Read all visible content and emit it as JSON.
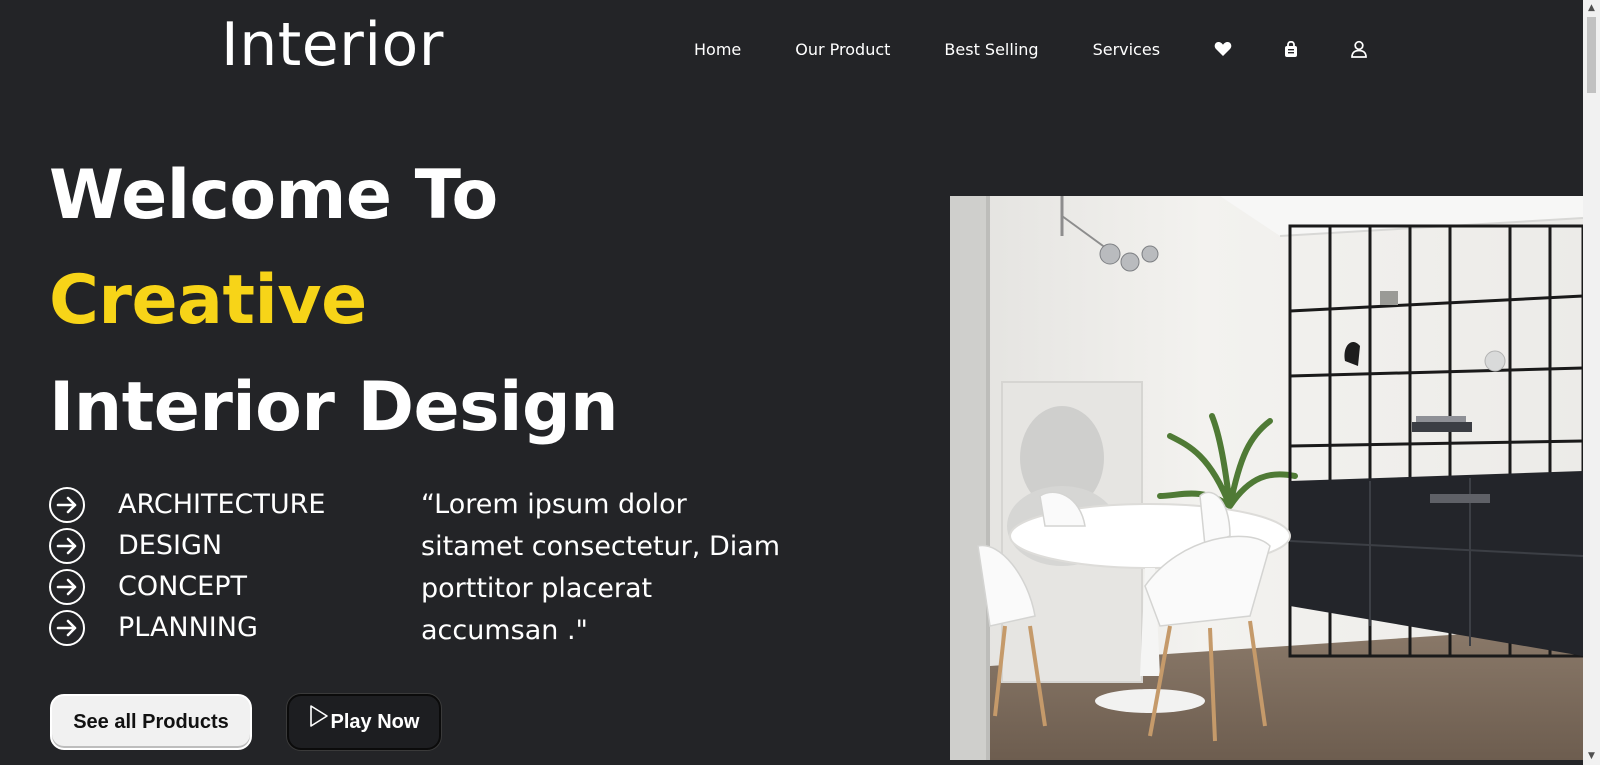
{
  "brand": {
    "logo_text": "Interior"
  },
  "nav": {
    "items": [
      {
        "label": "Home"
      },
      {
        "label": "Our Product"
      },
      {
        "label": "Best Selling"
      },
      {
        "label": "Services"
      }
    ],
    "icons": [
      "heart-icon",
      "shopping-bag-icon",
      "user-icon"
    ]
  },
  "hero": {
    "line1": "Welcome To",
    "line2": "Creative",
    "line3": "Interior Design",
    "accent_color": "#f7d418"
  },
  "features": [
    {
      "label": "ARCHITECTURE"
    },
    {
      "label": "DESIGN"
    },
    {
      "label": "CONCEPT"
    },
    {
      "label": "PLANNING"
    }
  ],
  "quote": "“Lorem ipsum dolor\nsitamet consectetur, Diam\nporttitor placerat\naccumsan .\"",
  "buttons": {
    "products_label": "See all Products",
    "play_label": "Play Now"
  },
  "colors": {
    "background": "#232427",
    "text": "#ffffff"
  }
}
